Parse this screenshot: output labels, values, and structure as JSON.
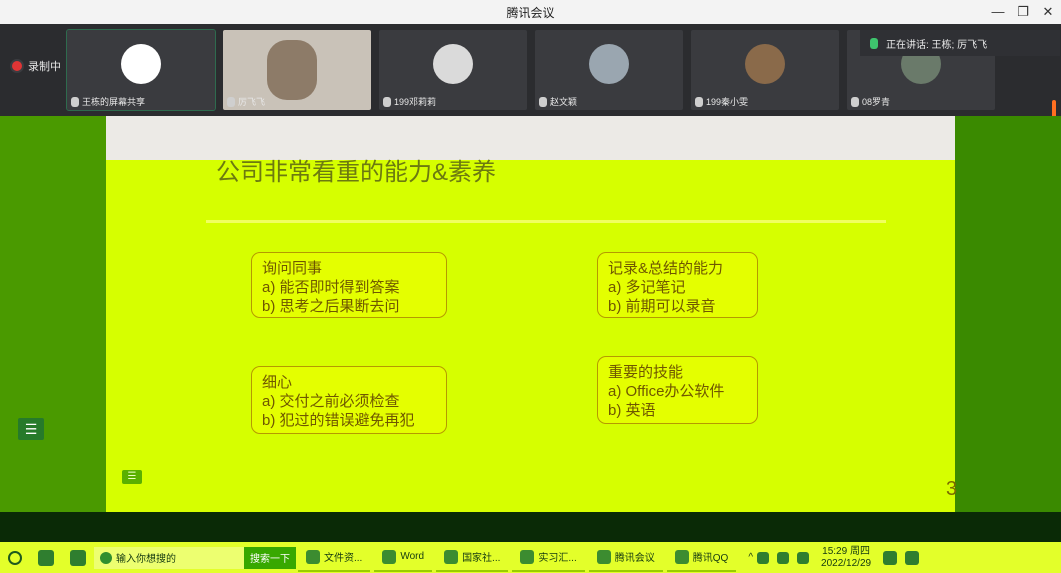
{
  "window": {
    "title": "腾讯会议",
    "min": "—",
    "restore": "❐",
    "close": "✕"
  },
  "recording": {
    "label": "录制中"
  },
  "participants": [
    {
      "name": "王栋的屏幕共享",
      "avatar_color": "#ffffff"
    },
    {
      "name": "厉飞飞",
      "avatar_color": "#b7a58f"
    },
    {
      "name": "199邓莉莉",
      "avatar_color": "#dadada"
    },
    {
      "name": "赵文颖",
      "avatar_color": "#9aa6b0"
    },
    {
      "name": "199秦小雯",
      "avatar_color": "#8a6a4a"
    },
    {
      "name": "08罗青",
      "avatar_color": "#6a7a6a"
    }
  ],
  "speaking": {
    "label": "正在讲话: 王栋; 厉飞飞"
  },
  "slide": {
    "title": "公司非常看重的能力&素养",
    "boxes": [
      {
        "heading": "询问同事",
        "lines": [
          "a) 能否即时得到答案",
          "b) 思考之后果断去问"
        ]
      },
      {
        "heading": "记录&总结的能力",
        "lines": [
          "a) 多记笔记",
          "b) 前期可以录音"
        ]
      },
      {
        "heading": "细心",
        "lines": [
          "a) 交付之前必须检查",
          "b) 犯过的错误避免再犯"
        ]
      },
      {
        "heading": "重要的技能",
        "lines": [
          "a) Office办公软件",
          "b) 英语"
        ]
      }
    ],
    "page_number": "3"
  },
  "taskbar": {
    "search_placeholder": "输入你想搜的",
    "search_button": "搜索一下",
    "tasks": [
      "文件资...",
      "Word",
      "国家社...",
      "实习汇...",
      "腾讯会议",
      "腾讯QQ"
    ],
    "time": "15:29 周四",
    "date": "2022/12/29"
  },
  "colors": {
    "accent": "#d6ff00",
    "record": "#e13535",
    "speaking_mic": "#3ec46d"
  }
}
